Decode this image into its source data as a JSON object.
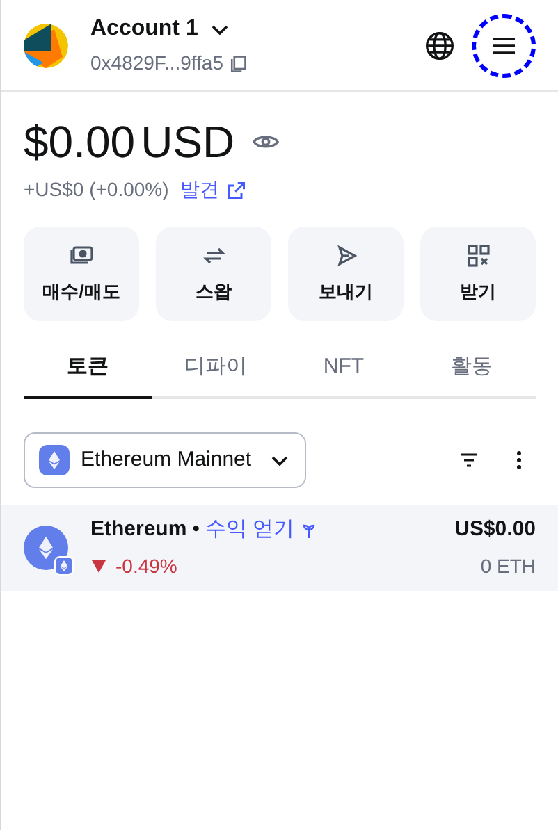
{
  "account": {
    "name": "Account 1",
    "address": "0x4829F...9ffa5"
  },
  "header": {
    "menu_highlighted": true
  },
  "balance": {
    "amount": "$0.00",
    "currency": "USD",
    "change": "+US$0 (+0.00%)",
    "link": "발견"
  },
  "actions": [
    {
      "kind": "buy",
      "label": "매수/매도"
    },
    {
      "kind": "swap",
      "label": "스왑"
    },
    {
      "kind": "send",
      "label": "보내기"
    },
    {
      "kind": "receive",
      "label": "받기"
    }
  ],
  "tabs": [
    {
      "label": "토큰",
      "selected": true
    },
    {
      "label": "디파이",
      "selected": false
    },
    {
      "label": "NFT",
      "selected": false
    },
    {
      "label": "활동",
      "selected": false
    }
  ],
  "network": {
    "label": "Ethereum Mainnet"
  },
  "tokens": [
    {
      "name": "Ethereum",
      "separator": "•",
      "earn": "수익 얻기",
      "change": "-0.49%",
      "down": true,
      "value": "US$0.00",
      "amount": "0 ETH"
    }
  ]
}
